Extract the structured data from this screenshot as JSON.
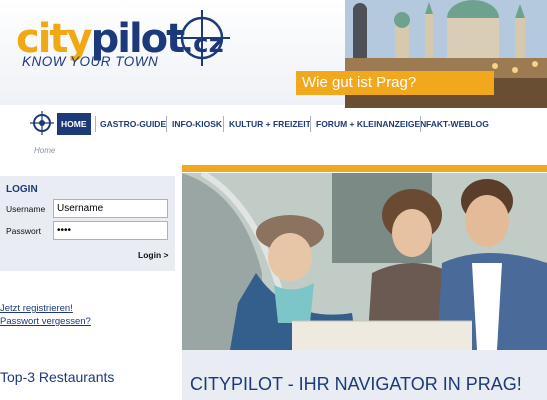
{
  "header": {
    "logo": {
      "part1": "city",
      "part2": "pilot",
      "tld": ".cz"
    },
    "tagline": "KNOW YOUR TOWN",
    "slogan": "Wie gut ist Prag?",
    "brand_colors": {
      "orange": "#f2a81c",
      "navy": "#1c3a7a"
    }
  },
  "nav": {
    "icon": "crosshair-icon",
    "items": [
      {
        "label": "HOME",
        "active": true
      },
      {
        "label": "GASTRO-GUIDE",
        "active": false
      },
      {
        "label": "INFO-KIOSK",
        "active": false
      },
      {
        "label": "KULTUR + FREIZEIT",
        "active": false
      },
      {
        "label": "FORUM + KLEINANZEIGEN",
        "active": false
      },
      {
        "label": "FAKT-WEBLOG",
        "active": false
      }
    ]
  },
  "breadcrumb": "Home",
  "login": {
    "title": "LOGIN",
    "username_label": "Username",
    "username_value": "Username",
    "password_label": "Passwort",
    "password_value": "••••",
    "submit_label": "Login >"
  },
  "links": {
    "register": "Jetzt registrieren!",
    "forgot": "Passwort vergessen?"
  },
  "sidebar": {
    "top3_title": "Top-3 Restaurants"
  },
  "main": {
    "headline": "CITYPILOT - IHR NAVIGATOR IN PRAG!"
  }
}
